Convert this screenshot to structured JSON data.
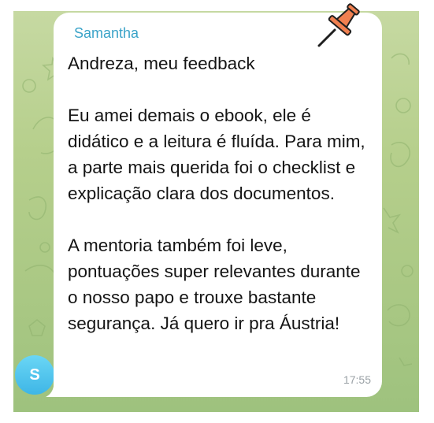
{
  "message": {
    "sender": "Samantha",
    "paragraphs": [
      "Andreza, meu feedback",
      "Eu amei demais o ebook, ele é didático e a leitura é fluída. Para mim, a parte mais querida foi o checklist e explicação clara dos documentos.",
      "A mentoria também foi leve, pontuações super relevantes durante o nosso papo e trouxe bastante segurança. Já quero ir pra Áustria!"
    ],
    "time": "17:55"
  },
  "avatar": {
    "initial": "S"
  },
  "icons": {
    "pin": "pushpin-icon"
  },
  "colors": {
    "sender": "#3aa3c8",
    "avatar": "#3eb6e6",
    "chat_background": "#b6cf8c",
    "pin": "#f08050"
  }
}
